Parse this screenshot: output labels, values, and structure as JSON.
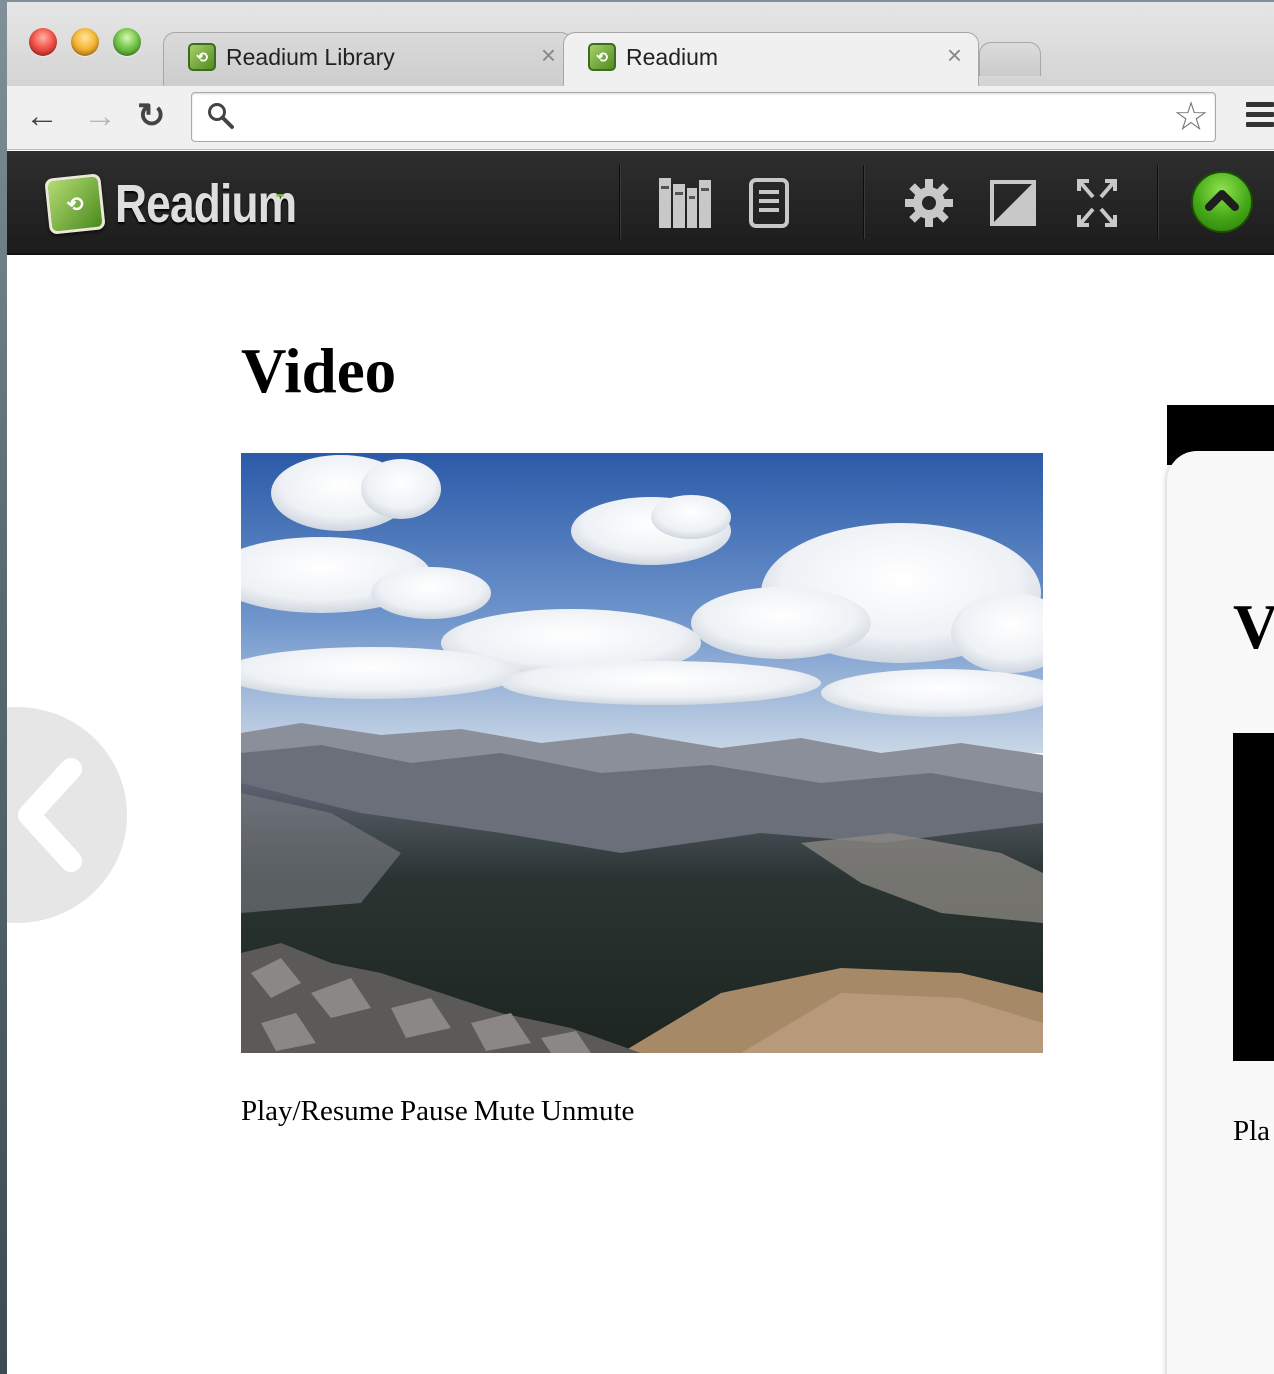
{
  "browser": {
    "tabs": [
      {
        "title": "Readium Library",
        "close": "×"
      },
      {
        "title": "Readium",
        "close": "×"
      }
    ],
    "address": {
      "value": "",
      "placeholder": ""
    }
  },
  "app": {
    "brand": "Readium",
    "brand_caret": "-",
    "accent_color": "#5fb82a",
    "toolbar_icons": [
      "library-icon",
      "toc-icon",
      "settings-icon",
      "contrast-icon",
      "fullscreen-icon",
      "up-arrow-icon"
    ]
  },
  "page": {
    "title": "Video",
    "controls": {
      "play": "Play/Resume",
      "pause": "Pause",
      "mute": "Mute",
      "unmute": "Unmute"
    }
  },
  "next_page_peek": {
    "title": "V",
    "text": "Pla"
  }
}
